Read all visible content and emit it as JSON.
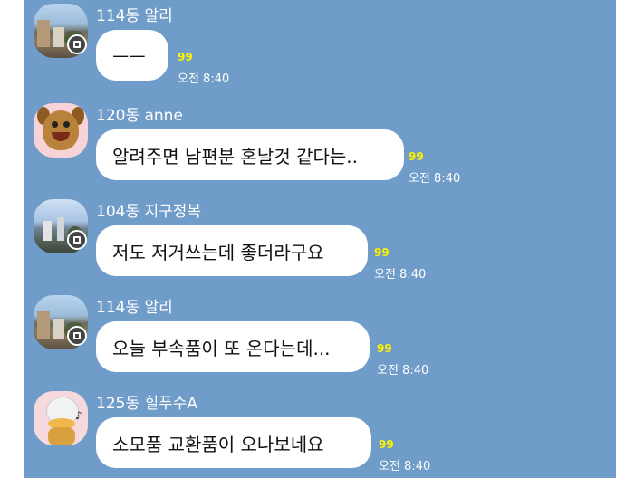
{
  "messages": [
    {
      "sender": "114동 알리",
      "text": "ㅡㅡ",
      "unread": "99",
      "time": "오전 8:40",
      "avatar": "apartment-photo-icon"
    },
    {
      "sender": "120동 anne",
      "text": "알려주면 남편분 혼날것 같다는..",
      "unread": "99",
      "time": "오전 8:40",
      "avatar": "dog-character-icon"
    },
    {
      "sender": "104동 지구정복",
      "text": "저도 저거쓰는데 좋더라구요",
      "unread": "99",
      "time": "오전 8:40",
      "avatar": "city-photo-icon"
    },
    {
      "sender": "114동 알리",
      "text": "오늘 부속품이 또 온다는데...",
      "unread": "99",
      "time": "오전 8:40",
      "avatar": "apartment-photo-icon"
    },
    {
      "sender": "125동 힐푸수A",
      "text": "소모품 교환품이 오나보네요",
      "unread": "99",
      "time": "오전 8:40",
      "avatar": "duck-character-icon"
    }
  ],
  "colors": {
    "chat_background": "#6f9cc8",
    "bubble": "#ffffff",
    "unread": "#fff200"
  }
}
